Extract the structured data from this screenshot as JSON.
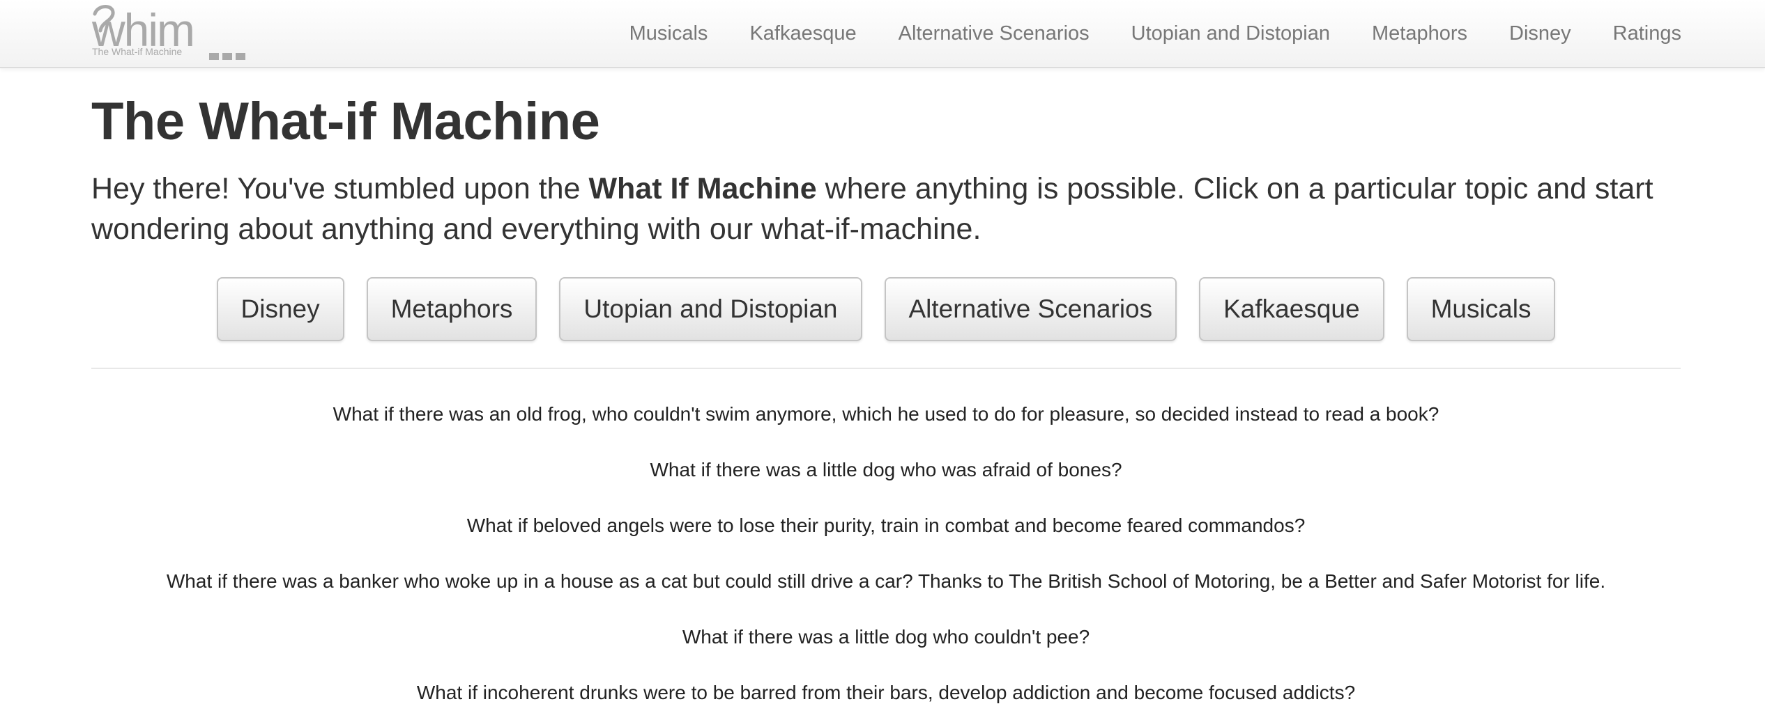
{
  "colors": {
    "text": "#333333",
    "nav_link": "#777777",
    "navbar_bg": "#f7f7f7",
    "button_bg": "#eeeeee",
    "logo_gray": "#a9a9a9"
  },
  "logo": {
    "wordmark": "whim",
    "tagline": "The What-if Machine"
  },
  "nav": {
    "items": [
      {
        "label": "Musicals"
      },
      {
        "label": "Kafkaesque"
      },
      {
        "label": "Alternative Scenarios"
      },
      {
        "label": "Utopian and Distopian"
      },
      {
        "label": "Metaphors"
      },
      {
        "label": "Disney"
      },
      {
        "label": "Ratings"
      }
    ]
  },
  "header": {
    "title": "The What-if Machine",
    "lead_before": "Hey there! You've stumbled upon the ",
    "lead_bold": "What If Machine",
    "lead_after": " where anything is possible. Click on a particular topic and start wondering about anything and everything with our what-if-machine."
  },
  "topics": [
    {
      "label": "Disney"
    },
    {
      "label": "Metaphors"
    },
    {
      "label": "Utopian and Distopian"
    },
    {
      "label": "Alternative Scenarios"
    },
    {
      "label": "Kafkaesque"
    },
    {
      "label": "Musicals"
    }
  ],
  "questions": [
    {
      "text": "What if there was an old frog, who couldn't swim anymore, which he used to do for pleasure, so decided instead to read a book?"
    },
    {
      "text": "What if there was a little dog who was afraid of bones?"
    },
    {
      "text": "What if beloved angels were to lose their purity, train in combat and become feared commandos?"
    },
    {
      "text": "What if there was a banker who woke up in a house as a cat but could still drive a car? Thanks to The British School of Motoring, be a Better and Safer Motorist for life."
    },
    {
      "text": "What if there was a little dog who couldn't pee?"
    },
    {
      "text": "What if incoherent drunks were to be barred from their bars, develop addiction and become focused addicts?"
    }
  ]
}
